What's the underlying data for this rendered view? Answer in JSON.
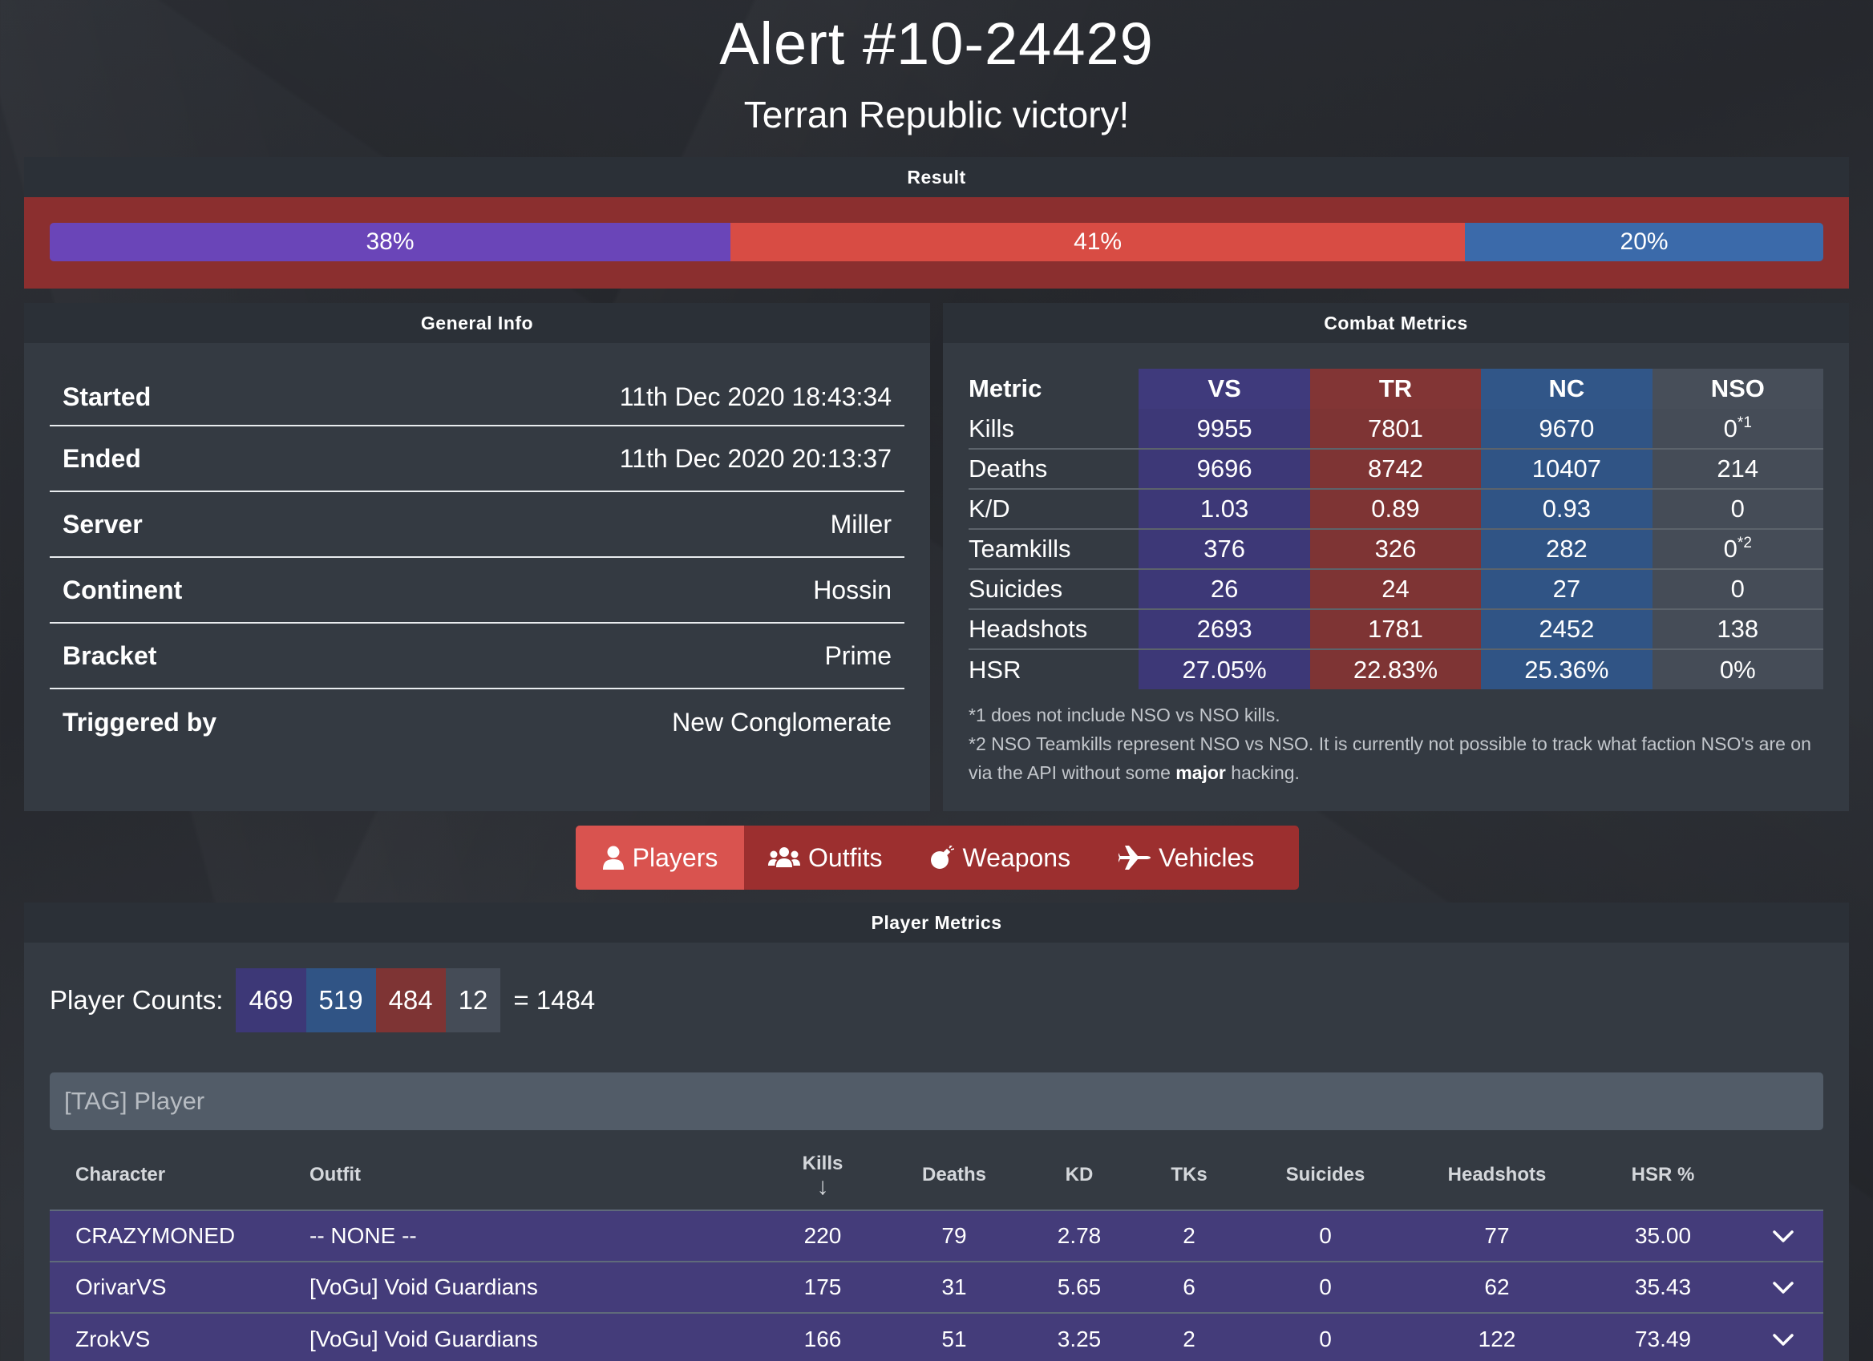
{
  "header": {
    "title": "Alert #10-24429",
    "subtitle": "Terran Republic victory!"
  },
  "result": {
    "heading": "Result",
    "segments": [
      {
        "faction": "VS",
        "label": "38%",
        "value": 0.38,
        "color": "#6a45b8"
      },
      {
        "faction": "TR",
        "label": "41%",
        "value": 0.41,
        "color": "#d84c44"
      },
      {
        "faction": "NC",
        "label": "20%",
        "value": 0.2,
        "color": "#3b6aaa"
      }
    ]
  },
  "general": {
    "heading": "General Info",
    "rows": [
      {
        "key": "Started",
        "value": "11th Dec 2020 18:43:34"
      },
      {
        "key": "Ended",
        "value": "11th Dec 2020 20:13:37"
      },
      {
        "key": "Server",
        "value": "Miller"
      },
      {
        "key": "Continent",
        "value": "Hossin"
      },
      {
        "key": "Bracket",
        "value": "Prime"
      },
      {
        "key": "Triggered by",
        "value": "New Conglomerate"
      }
    ]
  },
  "combat": {
    "heading": "Combat Metrics",
    "columns": [
      "Metric",
      "VS",
      "TR",
      "NC",
      "NSO"
    ],
    "rows": [
      {
        "metric": "Kills",
        "vs": "9955",
        "tr": "7801",
        "nc": "9670",
        "nso": "0",
        "nso_sup": "*1"
      },
      {
        "metric": "Deaths",
        "vs": "9696",
        "tr": "8742",
        "nc": "10407",
        "nso": "214"
      },
      {
        "metric": "K/D",
        "vs": "1.03",
        "tr": "0.89",
        "nc": "0.93",
        "nso": "0"
      },
      {
        "metric": "Teamkills",
        "vs": "376",
        "tr": "326",
        "nc": "282",
        "nso": "0",
        "nso_sup": "*2"
      },
      {
        "metric": "Suicides",
        "vs": "26",
        "tr": "24",
        "nc": "27",
        "nso": "0"
      },
      {
        "metric": "Headshots",
        "vs": "2693",
        "tr": "1781",
        "nc": "2452",
        "nso": "138"
      },
      {
        "metric": "HSR",
        "vs": "27.05%",
        "tr": "22.83%",
        "nc": "25.36%",
        "nso": "0%"
      }
    ],
    "note1": "*1 does not include NSO vs NSO kills.",
    "note2_before": "*2 NSO Teamkills represent NSO vs NSO. It is currently not possible to track what faction NSO's are on via the API without some ",
    "note2_bold": "major",
    "note2_after": " hacking."
  },
  "tabs": [
    {
      "label": "Players",
      "icon": "user-icon",
      "active": true
    },
    {
      "label": "Outfits",
      "icon": "users-icon",
      "active": false
    },
    {
      "label": "Weapons",
      "icon": "bomb-icon",
      "active": false
    },
    {
      "label": "Vehicles",
      "icon": "plane-icon",
      "active": false
    }
  ],
  "players": {
    "heading": "Player Metrics",
    "counts_label": "Player Counts:",
    "counts": {
      "vs": "469",
      "nc": "519",
      "tr": "484",
      "nso": "12",
      "total": "= 1484"
    },
    "search_placeholder": "[TAG] Player",
    "columns": [
      "Character",
      "Outfit",
      "Kills",
      "Deaths",
      "KD",
      "TKs",
      "Suicides",
      "Headshots",
      "HSR %"
    ],
    "sort_indicator": "↓",
    "rows": [
      {
        "character": "CRAZYMONED",
        "outfit": "-- NONE --",
        "kills": "220",
        "deaths": "79",
        "kd": "2.78",
        "tks": "2",
        "suicides": "0",
        "headshots": "77",
        "hsr": "35.00"
      },
      {
        "character": "OrivarVS",
        "outfit": "[VoGu] Void Guardians",
        "kills": "175",
        "deaths": "31",
        "kd": "5.65",
        "tks": "6",
        "suicides": "0",
        "headshots": "62",
        "hsr": "35.43"
      },
      {
        "character": "ZrokVS",
        "outfit": "[VoGu] Void Guardians",
        "kills": "166",
        "deaths": "51",
        "kd": "3.25",
        "tks": "2",
        "suicides": "0",
        "headshots": "122",
        "hsr": "73.49"
      }
    ]
  }
}
